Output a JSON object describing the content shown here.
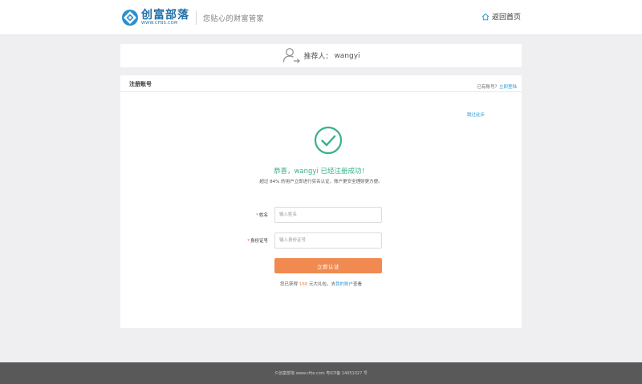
{
  "header": {
    "logo_name": "创富部落",
    "logo_domain": "WWW.CFBS.COM",
    "slogan": "您贴心的财富管家",
    "home_label": "返回首页"
  },
  "referrer": {
    "label": "推荐人：",
    "name": "wangyi"
  },
  "register": {
    "title": "注册账号",
    "have_account": "已有账号？",
    "login_now": "立即登陆",
    "skip": "跳过此步"
  },
  "success": {
    "title": "恭喜，wangyi 已经注册成功！",
    "subtitle": "超过 84% 的用户立即进行实名认证，账户更安全理财更方便。"
  },
  "form": {
    "name_label": "姓名",
    "name_placeholder": "输入姓名",
    "id_label": "身份证号",
    "id_placeholder": "输入身份证号",
    "required_mark": "*",
    "submit_label": "立即认证"
  },
  "gift": {
    "prefix": "您已获得 ",
    "amount": "188",
    "suffix": " 元大礼包，去",
    "link": "我的账户",
    "end": "查看"
  },
  "footer": {
    "text": "©创富部落 www.cfbs.com 粤ICP备 14051027 号"
  },
  "colors": {
    "accent": "#f18a50",
    "success": "#35b288",
    "link": "#2f9bd8",
    "brand": "#1f6fa8"
  }
}
